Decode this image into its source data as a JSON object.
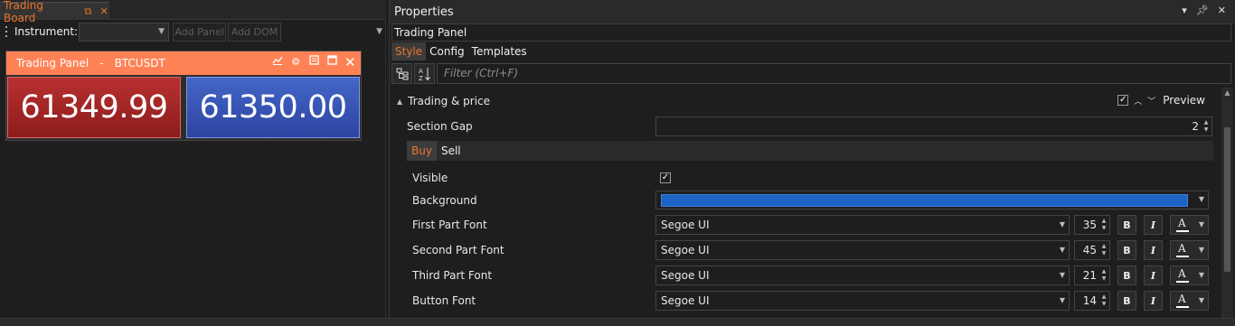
{
  "left_pane": {
    "tab": {
      "label": "Trading Board",
      "float_icon": "float-window-icon",
      "close_icon": "close-icon"
    },
    "toolbar": {
      "instrument_label": "Instrument:",
      "instrument_value": "",
      "add_panel_label": "Add Panel",
      "add_dom_label": "Add DOM"
    },
    "trading_panel": {
      "title": "Trading Panel",
      "separator": "-",
      "symbol": "BTCUSDT",
      "header_icons": [
        "chart-icon",
        "gear-icon",
        "notes-icon",
        "maximize-icon",
        "close-icon"
      ],
      "sell_price": "61349.99",
      "buy_price": "61350.00",
      "colors": {
        "header": "#ff8257",
        "sell": "#a82626",
        "buy": "#3a55b8"
      }
    }
  },
  "properties": {
    "title": "Properties",
    "title_icons": [
      "dropdown-icon",
      "pin-icon",
      "close-icon"
    ],
    "object_name": "Trading Panel",
    "tabs": [
      {
        "label": "Style",
        "active": true
      },
      {
        "label": "Config",
        "active": false
      },
      {
        "label": "Templates",
        "active": false
      }
    ],
    "filter_placeholder": "Filter (Ctrl+F)",
    "section": {
      "title": "Trading & price",
      "preview_label": "Preview",
      "preview_checked": true,
      "section_gap_label": "Section Gap",
      "section_gap_value": "2",
      "side_tabs": [
        {
          "label": "Buy",
          "active": true
        },
        {
          "label": "Sell",
          "active": false
        }
      ],
      "visible_label": "Visible",
      "visible_checked": true,
      "background_label": "Background",
      "background_color": "#1c63c4",
      "font_rows": [
        {
          "label": "First Part Font",
          "font": "Segoe UI",
          "size": "35"
        },
        {
          "label": "Second Part Font",
          "font": "Segoe UI",
          "size": "45"
        },
        {
          "label": "Third Part Font",
          "font": "Segoe UI",
          "size": "21"
        },
        {
          "label": "Button Font",
          "font": "Segoe UI",
          "size": "14"
        }
      ],
      "bold_label": "B",
      "italic_label": "I",
      "color_label": "A"
    }
  },
  "accent_color": "#e8752b"
}
